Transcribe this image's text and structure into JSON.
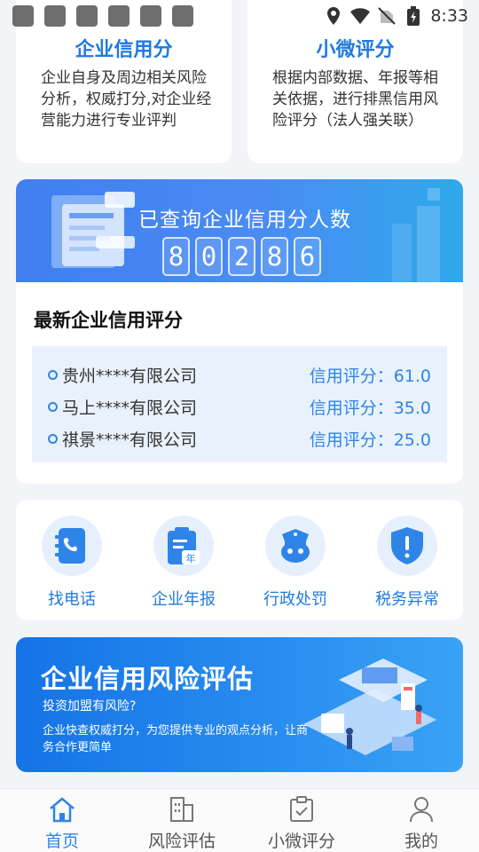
{
  "status_bar": {
    "time": "8:33"
  },
  "top_cards": [
    {
      "title": "企业信用分",
      "desc": "企业自身及周边相关风险分析，权威打分,对企业经营能力进行专业评判"
    },
    {
      "title": "小微评分",
      "desc": "根据内部数据、年报等相关依据，进行排黑信用风险评分（法人强关联）"
    }
  ],
  "counter": {
    "title": "已查询企业信用分人数",
    "digits": [
      "8",
      "0",
      "2",
      "8",
      "6"
    ]
  },
  "latest": {
    "title": "最新企业信用评分",
    "rows": [
      {
        "name": "贵州****有限公司",
        "score": "信用评分：61.0"
      },
      {
        "name": "马上****有限公司",
        "score": "信用评分：35.0"
      },
      {
        "name": "祺景****有限公司",
        "score": "信用评分：25.0"
      }
    ]
  },
  "quick": [
    {
      "label": "找电话",
      "icon": "phone-book-icon"
    },
    {
      "label": "企业年报",
      "icon": "annual-report-icon"
    },
    {
      "label": "行政处罚",
      "icon": "police-icon"
    },
    {
      "label": "税务异常",
      "icon": "shield-alert-icon"
    }
  ],
  "risk_banner": {
    "title": "企业信用风险评估",
    "subtitle": "投资加盟有风险?",
    "desc": "企业快查权威打分，为您提供专业的观点分析，让商务合作更简单"
  },
  "nav": [
    {
      "label": "首页",
      "icon": "home-icon",
      "active": true
    },
    {
      "label": "风险评估",
      "icon": "building-icon",
      "active": false
    },
    {
      "label": "小微评分",
      "icon": "clipboard-icon",
      "active": false
    },
    {
      "label": "我的",
      "icon": "user-icon",
      "active": false
    }
  ],
  "colors": {
    "accent": "#2f84e8",
    "title_blue": "#1f7ae0"
  }
}
